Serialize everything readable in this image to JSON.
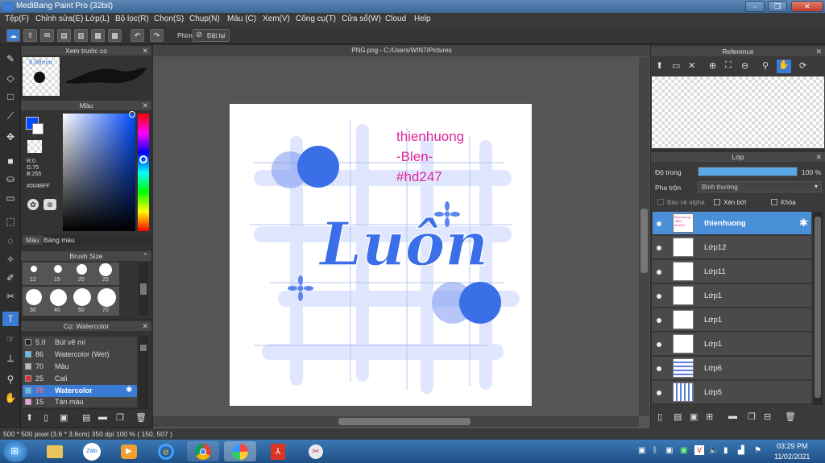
{
  "window": {
    "title": "MediBang Paint Pro (32bit)"
  },
  "menu": [
    "Tệp(F)",
    "Chỉnh sửa(E)",
    "Lớp(L)",
    "Bộ lọc(R)",
    "Chọn(S)",
    "Chụp(N)",
    "Màu (C)",
    "Xem(V)",
    "Công cụ(T)",
    "Cửa sổ(W)",
    "Cloud",
    "Help"
  ],
  "toolbar": {
    "shortcut_label": "Phím",
    "reset_label": "Đặt lại"
  },
  "brush_preview": {
    "title": "Xem trước cọ",
    "size": "5.08mm"
  },
  "color_panel": {
    "title": "Màu",
    "r": "R:0",
    "g": "G:75",
    "b": "B:255",
    "hex": "#004BFF",
    "tab_color": "Màu",
    "tab_palette": "Bảng màu",
    "current_color": "#004BFF"
  },
  "brush_size": {
    "title": "Brush Size",
    "sizes": [
      "12",
      "15",
      "20",
      "25",
      "30",
      "40",
      "50",
      "70"
    ]
  },
  "brush_list": {
    "title": "Cọ: Watercolor",
    "items": [
      {
        "size": "5.0",
        "name": "Bút vẽ mí",
        "color": "#222222"
      },
      {
        "size": "86",
        "name": "Watercolor (Wet)",
        "color": "#5bc0eb"
      },
      {
        "size": "70",
        "name": "Màu",
        "color": "#bbbbbb"
      },
      {
        "size": "25",
        "name": "Cali",
        "color": "#e03030"
      },
      {
        "size": "70",
        "name": "Watercolor",
        "color": "#5bc0eb",
        "selected": true
      },
      {
        "size": "15",
        "name": "Tán màu",
        "color": "#f0a0e0"
      }
    ]
  },
  "document": {
    "tab": "PNG.png - C:/Users/WIN7/Pictures",
    "art_text": [
      "thienhuong",
      "-Blen-",
      "#hd247"
    ],
    "art_word": "Luôn"
  },
  "reference": {
    "title": "Reference"
  },
  "layers": {
    "title": "Lớp",
    "opacity_label": "Độ trong",
    "opacity_value": "100 %",
    "opacity": 1.0,
    "blend_label": "Pha trộn",
    "blend_value": "Bình thường",
    "protect_alpha": "Bảo vệ alpha",
    "clipping": "Xén bớt",
    "lock": "Khóa",
    "items": [
      "thienhuong",
      "Lớp12",
      "Lớp11",
      "Lớp1",
      "Lớp1",
      "Lớp1",
      "Lớp6",
      "Lớp5"
    ]
  },
  "status": {
    "text": "500 * 500 pixel  (3.6 * 3.6cm)  350 dpi  100 %  ( 150, 507 )"
  },
  "taskbar": {
    "time": "03:29 PM",
    "date": "11/02/2021",
    "zalo": "Zalo"
  },
  "colors": {
    "accent": "#3a7bd5",
    "art_blue": "#3b6fe8",
    "art_pink": "#e0259a"
  }
}
